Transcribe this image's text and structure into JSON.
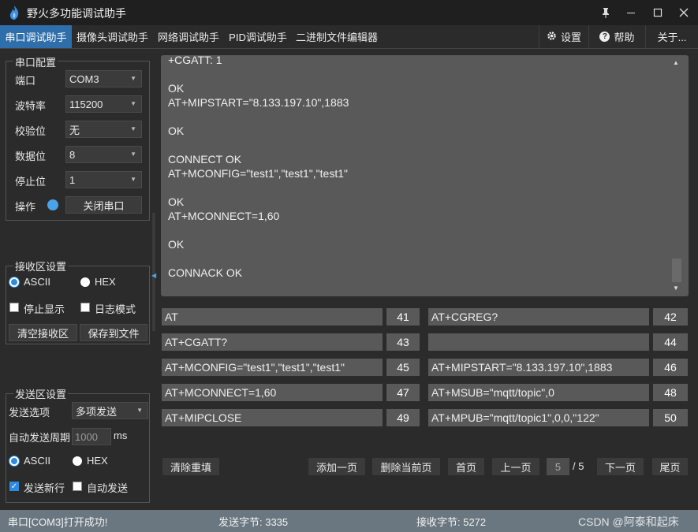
{
  "window": {
    "title": "野火多功能调试助手",
    "controls": [
      "pin-icon",
      "minimize-icon",
      "maximize-icon",
      "close-icon"
    ]
  },
  "tabs": [
    "串口调试助手",
    "摄像头调试助手",
    "网络调试助手",
    "PID调试助手",
    "二进制文件编辑器"
  ],
  "active_tab": 0,
  "toolbar": {
    "settings": "设置",
    "help": "帮助",
    "about": "关于..."
  },
  "serial_config": {
    "title": "串口配置",
    "port_label": "端口",
    "port_value": "COM3",
    "baud_label": "波特率",
    "baud_value": "115200",
    "parity_label": "校验位",
    "parity_value": "无",
    "databits_label": "数据位",
    "databits_value": "8",
    "stopbits_label": "停止位",
    "stopbits_value": "1",
    "op_label": "操作",
    "close_port_button": "关闭串口"
  },
  "recv_settings": {
    "title": "接收区设置",
    "ascii": "ASCII",
    "hex": "HEX",
    "stop_display": "停止显示",
    "log_mode": "日志模式",
    "clear_button": "清空接收区",
    "save_button": "保存到文件"
  },
  "send_settings": {
    "title": "发送区设置",
    "option_label": "发送选项",
    "option_value": "多项发送",
    "period_label": "自动发送周期",
    "period_value": "1000",
    "period_unit": "ms",
    "ascii": "ASCII",
    "hex": "HEX",
    "send_newline": "发送新行",
    "auto_send": "自动发送"
  },
  "receive_area": {
    "text": "+CGATT: 1\n\nOK\nAT+MIPSTART=\"8.133.197.10\",1883\n\nOK\n\nCONNECT OK\nAT+MCONFIG=\"test1\",\"test1\",\"test1\"\n\nOK\nAT+MCONNECT=1,60\n\nOK\n\nCONNACK OK"
  },
  "commands": [
    {
      "text": "AT",
      "num": "41"
    },
    {
      "text": "AT+CGREG?",
      "num": "42"
    },
    {
      "text": "AT+CGATT?",
      "num": "43"
    },
    {
      "text": "",
      "num": "44"
    },
    {
      "text": "AT+MCONFIG=\"test1\",\"test1\",\"test1\"",
      "num": "45"
    },
    {
      "text": "AT+MIPSTART=\"8.133.197.10\",1883",
      "num": "46"
    },
    {
      "text": "AT+MCONNECT=1,60",
      "num": "47"
    },
    {
      "text": "AT+MSUB=\"mqtt/topic\",0",
      "num": "48"
    },
    {
      "text": "AT+MIPCLOSE",
      "num": "49"
    },
    {
      "text": "AT+MPUB=\"mqtt/topic1\",0,0,\"122\"",
      "num": "50"
    }
  ],
  "pager": {
    "clear_refill": "清除重填",
    "add_page": "添加一页",
    "delete_page": "删除当前页",
    "first": "首页",
    "prev": "上一页",
    "current": "5",
    "total": "/ 5",
    "next": "下一页",
    "last": "尾页"
  },
  "status": {
    "message": "串口[COM3]打开成功!",
    "sent": "发送字节: 3335",
    "received": "接收字节: 5272",
    "watermark": "CSDN @阿泰和起床"
  },
  "colors": {
    "accent": "#2e6eaa",
    "status_bar": "#6a7780",
    "radio_on": "#2e8be0"
  }
}
